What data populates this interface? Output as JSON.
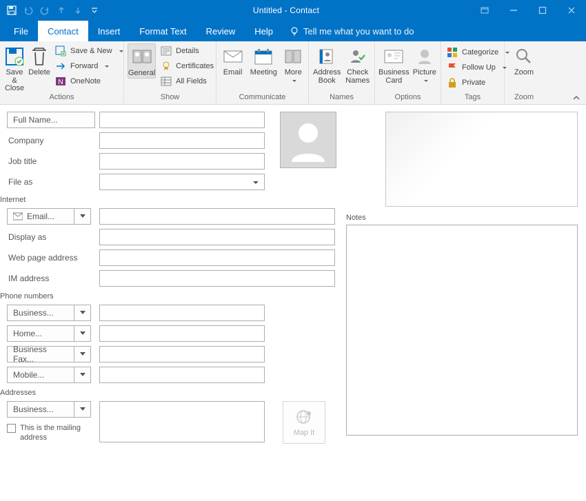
{
  "title": "Untitled  -  Contact",
  "tabs": {
    "file": "File",
    "contact": "Contact",
    "insert": "Insert",
    "format": "Format Text",
    "review": "Review",
    "help": "Help"
  },
  "tellme": "Tell me what you want to do",
  "ribbon": {
    "actions": {
      "label": "Actions",
      "save_close": "Save & Close",
      "delete": "Delete",
      "save_new": "Save & New",
      "forward": "Forward",
      "onenote": "OneNote"
    },
    "show": {
      "label": "Show",
      "general": "General",
      "details": "Details",
      "certificates": "Certificates",
      "all_fields": "All Fields"
    },
    "communicate": {
      "label": "Communicate",
      "email": "Email",
      "meeting": "Meeting",
      "more": "More"
    },
    "names": {
      "label": "Names",
      "address_book": "Address Book",
      "check_names": "Check Names"
    },
    "options": {
      "label": "Options",
      "business_card": "Business Card",
      "picture": "Picture"
    },
    "tags": {
      "label": "Tags",
      "categorize": "Categorize",
      "follow_up": "Follow Up",
      "private": "Private"
    },
    "zoom": {
      "label": "Zoom",
      "zoom": "Zoom"
    }
  },
  "form": {
    "full_name": "Full Name...",
    "company": "Company",
    "job_title": "Job title",
    "file_as": "File as",
    "internet": "Internet",
    "email": "Email...",
    "display_as": "Display as",
    "web_page": "Web page address",
    "im": "IM address",
    "phone_section": "Phone numbers",
    "phone1": "Business...",
    "phone2": "Home...",
    "phone3": "Business Fax...",
    "phone4": "Mobile...",
    "addr_section": "Addresses",
    "addr_type": "Business...",
    "mailing": "This is the mailing address",
    "mapit": "Map It",
    "notes": "Notes"
  }
}
